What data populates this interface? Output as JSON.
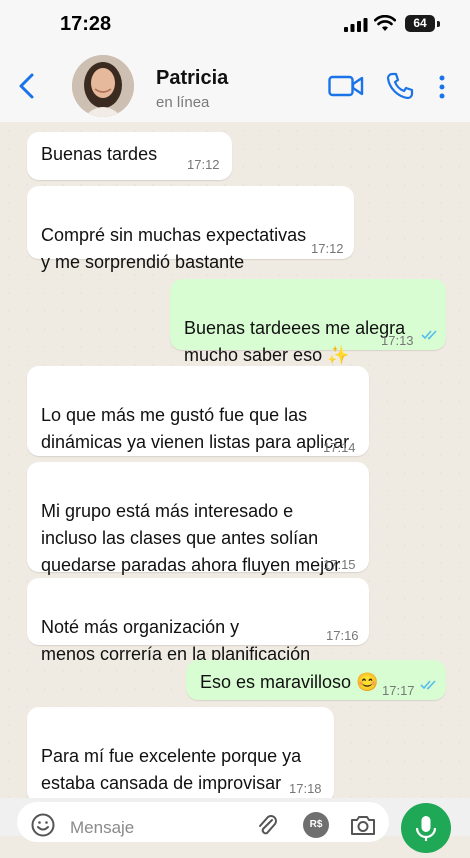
{
  "status_bar": {
    "time": "17:28",
    "battery": "64"
  },
  "header": {
    "contact_name": "Patricia",
    "contact_status": "en línea"
  },
  "messages": [
    {
      "dir": "in",
      "text": "Buenas tardes",
      "time": "17:12"
    },
    {
      "dir": "in",
      "text": "Compré sin muchas expectativas\ny me sorprendió bastante",
      "time": "17:12"
    },
    {
      "dir": "out",
      "text": "Buenas tardeees me alegra\nmucho saber eso ✨",
      "time": "17:13",
      "read": true
    },
    {
      "dir": "in",
      "text": "Lo que más me gustó fue que las\ndinámicas ya vienen listas para aplicar",
      "time": "17:14"
    },
    {
      "dir": "in",
      "text": "Mi grupo está más interesado e\nincluso las clases que antes solían\nquedarse paradas ahora fluyen mejor",
      "time": "17:15"
    },
    {
      "dir": "in",
      "text": "Noté más organización y\nmenos correría en la planificación",
      "time": "17:16"
    },
    {
      "dir": "out",
      "text": "Eso es maravilloso 😊",
      "time": "17:17",
      "read": true
    },
    {
      "dir": "in",
      "text": "Para mí fue excelente porque ya\nestaba cansada de improvisar\ntodo sola",
      "time": "17:18"
    }
  ],
  "input": {
    "placeholder": "Mensaje",
    "pay_label": "R$"
  },
  "colors": {
    "accent": "#1a73e8",
    "incoming": "#ffffff",
    "outgoing": "#d9fdd3",
    "read_ticks": "#53bdeb",
    "mic": "#1fa855"
  }
}
